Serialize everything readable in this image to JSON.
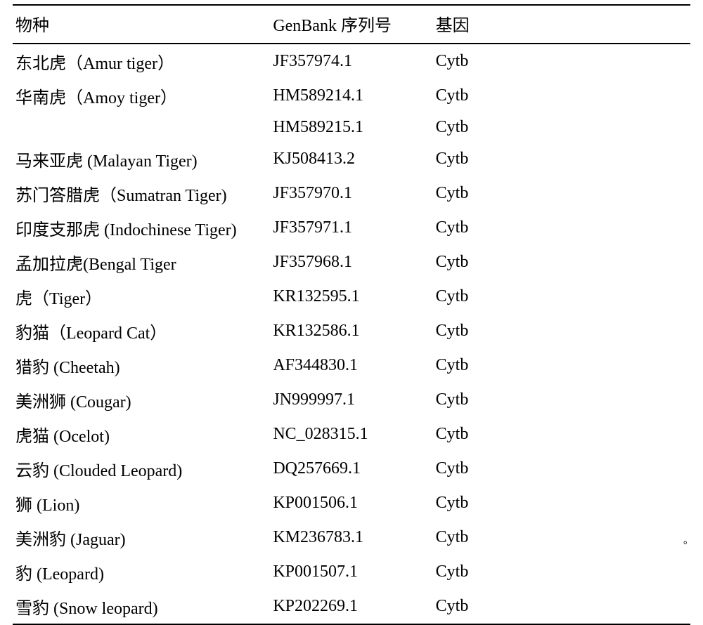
{
  "headers": {
    "species": "物种",
    "genbank_en": "GenBank",
    "genbank_cn": "序列号",
    "gene": "基因"
  },
  "rows": [
    {
      "species_cn": "东北虎",
      "species_paren": "（Amur tiger）",
      "genbank": "JF357974.1",
      "gene": "Cytb"
    },
    {
      "species_cn": "华南虎",
      "species_paren": "（Amoy tiger）",
      "genbank": "HM589214.1",
      "gene": "Cytb"
    },
    {
      "species_cn": "",
      "species_paren": "",
      "genbank": "HM589215.1",
      "gene": "Cytb"
    },
    {
      "species_cn": "马来亚虎",
      "species_paren": " (Malayan Tiger)",
      "genbank": "KJ508413.2",
      "gene": "Cytb"
    },
    {
      "species_cn": "苏门答腊虎",
      "species_paren": "（Sumatran Tiger)",
      "genbank": "JF357970.1",
      "gene": "Cytb"
    },
    {
      "species_cn": "印度支那虎",
      "species_paren": " (Indochinese Tiger)",
      "genbank": "JF357971.1",
      "gene": "Cytb"
    },
    {
      "species_cn": "孟加拉虎",
      "species_paren": "(Bengal Tiger",
      "genbank": "JF357968.1",
      "gene": "Cytb"
    },
    {
      "species_cn": "虎",
      "species_paren": "（Tiger）",
      "genbank": "KR132595.1",
      "gene": "Cytb"
    },
    {
      "species_cn": "豹猫",
      "species_paren": "（Leopard Cat）",
      "genbank": "KR132586.1",
      "gene": "Cytb"
    },
    {
      "species_cn": "猎豹",
      "species_paren": " (Cheetah)",
      "genbank": "AF344830.1",
      "gene": "Cytb"
    },
    {
      "species_cn": "美洲狮",
      "species_paren": " (Cougar)",
      "genbank": "JN999997.1",
      "gene": "Cytb"
    },
    {
      "species_cn": "虎猫",
      "species_paren": " (Ocelot)",
      "genbank": "NC_028315.1",
      "gene": "Cytb"
    },
    {
      "species_cn": "云豹",
      "species_paren": " (Clouded Leopard)",
      "genbank": "DQ257669.1",
      "gene": "Cytb"
    },
    {
      "species_cn": "狮",
      "species_paren": " (Lion)",
      "genbank": "KP001506.1",
      "gene": "Cytb"
    },
    {
      "species_cn": "美洲豹",
      "species_paren": " (Jaguar)",
      "genbank": "KM236783.1",
      "gene": "Cytb"
    },
    {
      "species_cn": "豹",
      "species_paren": " (Leopard)",
      "genbank": "KP001507.1",
      "gene": "Cytb"
    },
    {
      "species_cn": "雪豹",
      "species_paren": " (Snow leopard)",
      "genbank": "KP202269.1",
      "gene": "Cytb"
    }
  ],
  "footer_mark": "。"
}
